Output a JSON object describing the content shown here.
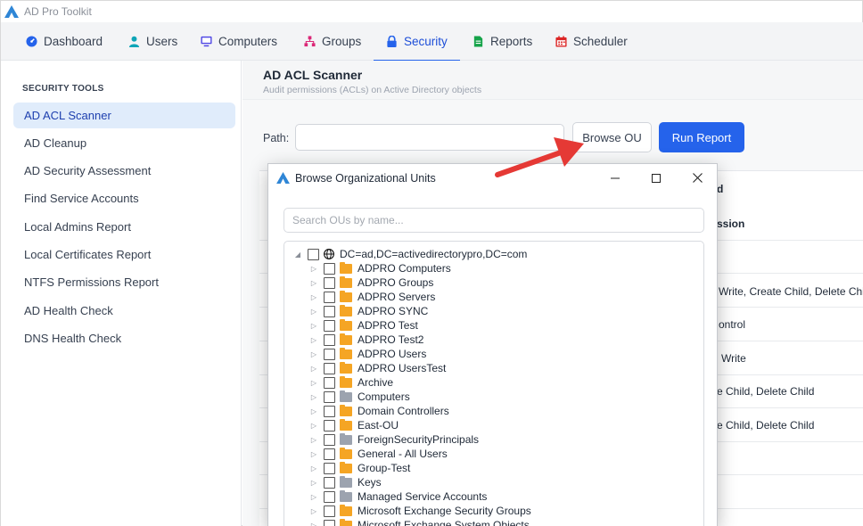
{
  "app": {
    "title": "AD Pro Toolkit"
  },
  "nav": {
    "tabs": [
      {
        "label": "Dashboard",
        "icon": "dashboard-icon",
        "color": "#2563eb"
      },
      {
        "label": "Users",
        "icon": "user-icon",
        "color": "#0ea5b7"
      },
      {
        "label": "Computers",
        "icon": "monitor-icon",
        "color": "#4f46e5"
      },
      {
        "label": "Groups",
        "icon": "groups-icon",
        "color": "#db2777"
      },
      {
        "label": "Security",
        "icon": "lock-icon",
        "color": "#2563eb",
        "active": true
      },
      {
        "label": "Reports",
        "icon": "report-icon",
        "color": "#16a34a"
      },
      {
        "label": "Scheduler",
        "icon": "calendar-icon",
        "color": "#dc2626"
      }
    ]
  },
  "sidebar": {
    "heading": "SECURITY TOOLS",
    "items": [
      {
        "label": "AD ACL Scanner",
        "active": true
      },
      {
        "label": "AD Cleanup"
      },
      {
        "label": "AD Security Assessment"
      },
      {
        "label": "Find Service Accounts"
      },
      {
        "label": "Local Admins Report"
      },
      {
        "label": "Local Certificates Report"
      },
      {
        "label": "NTFS Permissions Report"
      },
      {
        "label": "AD Health Check"
      },
      {
        "label": "DNS Health Check"
      }
    ]
  },
  "main": {
    "title": "AD ACL Scanner",
    "subtitle": "Audit permissions (ACLs) on Active Directory objects",
    "path_label": "Path:",
    "path_value": "",
    "browse_button": "Browse OU",
    "run_button": "Run Report"
  },
  "results_peek": {
    "header_partial": "d",
    "column_partial": "ssion",
    "rows": [
      "Write, Create Child, Delete Chi",
      "ontrol",
      "Write",
      "e Child, Delete Child",
      "e Child, Delete Child"
    ]
  },
  "dialog": {
    "title": "Browse Organizational Units",
    "search_placeholder": "Search OUs by name...",
    "root": {
      "label": "DC=ad,DC=activedirectorypro,DC=com",
      "expanded": true
    },
    "children": [
      {
        "label": "ADPRO Computers",
        "kind": "ou"
      },
      {
        "label": "ADPRO Groups",
        "kind": "ou"
      },
      {
        "label": "ADPRO Servers",
        "kind": "ou"
      },
      {
        "label": "ADPRO SYNC",
        "kind": "ou"
      },
      {
        "label": "ADPRO Test",
        "kind": "ou"
      },
      {
        "label": "ADPRO Test2",
        "kind": "ou"
      },
      {
        "label": "ADPRO Users",
        "kind": "ou"
      },
      {
        "label": "ADPRO UsersTest",
        "kind": "ou"
      },
      {
        "label": "Archive",
        "kind": "ou"
      },
      {
        "label": "Computers",
        "kind": "container"
      },
      {
        "label": "Domain Controllers",
        "kind": "ou"
      },
      {
        "label": "East-OU",
        "kind": "ou"
      },
      {
        "label": "ForeignSecurityPrincipals",
        "kind": "container"
      },
      {
        "label": "General - All Users",
        "kind": "ou"
      },
      {
        "label": "Group-Test",
        "kind": "ou"
      },
      {
        "label": "Keys",
        "kind": "container"
      },
      {
        "label": "Managed Service Accounts",
        "kind": "container"
      },
      {
        "label": "Microsoft Exchange Security Groups",
        "kind": "ou"
      },
      {
        "label": "Microsoft Exchange System Objects",
        "kind": "ou"
      }
    ]
  },
  "colors": {
    "accent": "#2563eb",
    "annotation_arrow": "#e53935"
  }
}
